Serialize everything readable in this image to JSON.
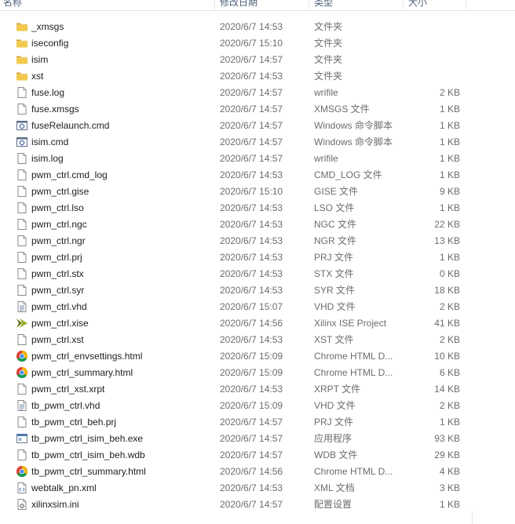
{
  "columns": {
    "name": "名称",
    "date": "修改日期",
    "type": "类型",
    "size": "大小"
  },
  "files": [
    {
      "name": "_xmsgs",
      "date": "2020/6/7 14:53",
      "type": "文件夹",
      "size": "",
      "icon": "folder-icon"
    },
    {
      "name": "iseconfig",
      "date": "2020/6/7 15:10",
      "type": "文件夹",
      "size": "",
      "icon": "folder-icon"
    },
    {
      "name": "isim",
      "date": "2020/6/7 14:57",
      "type": "文件夹",
      "size": "",
      "icon": "folder-icon"
    },
    {
      "name": "xst",
      "date": "2020/6/7 14:53",
      "type": "文件夹",
      "size": "",
      "icon": "folder-icon"
    },
    {
      "name": "fuse.log",
      "date": "2020/6/7 14:57",
      "type": "wrifile",
      "size": "2 KB",
      "icon": "file-icon"
    },
    {
      "name": "fuse.xmsgs",
      "date": "2020/6/7 14:57",
      "type": "XMSGS 文件",
      "size": "1 KB",
      "icon": "file-icon"
    },
    {
      "name": "fuseRelaunch.cmd",
      "date": "2020/6/7 14:57",
      "type": "Windows 命令脚本",
      "size": "1 KB",
      "icon": "cmd-script-icon"
    },
    {
      "name": "isim.cmd",
      "date": "2020/6/7 14:57",
      "type": "Windows 命令脚本",
      "size": "1 KB",
      "icon": "cmd-script-icon"
    },
    {
      "name": "isim.log",
      "date": "2020/6/7 14:57",
      "type": "wrifile",
      "size": "1 KB",
      "icon": "file-icon"
    },
    {
      "name": "pwm_ctrl.cmd_log",
      "date": "2020/6/7 14:53",
      "type": "CMD_LOG 文件",
      "size": "1 KB",
      "icon": "file-icon"
    },
    {
      "name": "pwm_ctrl.gise",
      "date": "2020/6/7 15:10",
      "type": "GISE 文件",
      "size": "9 KB",
      "icon": "file-icon"
    },
    {
      "name": "pwm_ctrl.lso",
      "date": "2020/6/7 14:53",
      "type": "LSO 文件",
      "size": "1 KB",
      "icon": "file-icon"
    },
    {
      "name": "pwm_ctrl.ngc",
      "date": "2020/6/7 14:53",
      "type": "NGC 文件",
      "size": "22 KB",
      "icon": "file-icon"
    },
    {
      "name": "pwm_ctrl.ngr",
      "date": "2020/6/7 14:53",
      "type": "NGR 文件",
      "size": "13 KB",
      "icon": "file-icon"
    },
    {
      "name": "pwm_ctrl.prj",
      "date": "2020/6/7 14:53",
      "type": "PRJ 文件",
      "size": "1 KB",
      "icon": "file-icon"
    },
    {
      "name": "pwm_ctrl.stx",
      "date": "2020/6/7 14:53",
      "type": "STX 文件",
      "size": "0 KB",
      "icon": "file-icon"
    },
    {
      "name": "pwm_ctrl.syr",
      "date": "2020/6/7 14:53",
      "type": "SYR 文件",
      "size": "18 KB",
      "icon": "file-icon"
    },
    {
      "name": "pwm_ctrl.vhd",
      "date": "2020/6/7 15:07",
      "type": "VHD 文件",
      "size": "2 KB",
      "icon": "text-file-icon"
    },
    {
      "name": "pwm_ctrl.xise",
      "date": "2020/6/7 14:56",
      "type": "Xilinx ISE Project",
      "size": "41 KB",
      "icon": "xilinx-ise-icon"
    },
    {
      "name": "pwm_ctrl.xst",
      "date": "2020/6/7 14:53",
      "type": "XST 文件",
      "size": "2 KB",
      "icon": "file-icon"
    },
    {
      "name": "pwm_ctrl_envsettings.html",
      "date": "2020/6/7 15:09",
      "type": "Chrome HTML D...",
      "size": "10 KB",
      "icon": "chrome-icon"
    },
    {
      "name": "pwm_ctrl_summary.html",
      "date": "2020/6/7 15:09",
      "type": "Chrome HTML D...",
      "size": "6 KB",
      "icon": "chrome-icon"
    },
    {
      "name": "pwm_ctrl_xst.xrpt",
      "date": "2020/6/7 14:53",
      "type": "XRPT 文件",
      "size": "14 KB",
      "icon": "file-icon"
    },
    {
      "name": "tb_pwm_ctrl.vhd",
      "date": "2020/6/7 15:09",
      "type": "VHD 文件",
      "size": "2 KB",
      "icon": "text-file-icon"
    },
    {
      "name": "tb_pwm_ctrl_beh.prj",
      "date": "2020/6/7 14:57",
      "type": "PRJ 文件",
      "size": "1 KB",
      "icon": "file-icon"
    },
    {
      "name": "tb_pwm_ctrl_isim_beh.exe",
      "date": "2020/6/7 14:57",
      "type": "应用程序",
      "size": "93 KB",
      "icon": "exe-icon"
    },
    {
      "name": "tb_pwm_ctrl_isim_beh.wdb",
      "date": "2020/6/7 14:57",
      "type": "WDB 文件",
      "size": "29 KB",
      "icon": "file-icon"
    },
    {
      "name": "tb_pwm_ctrl_summary.html",
      "date": "2020/6/7 14:56",
      "type": "Chrome HTML D...",
      "size": "4 KB",
      "icon": "chrome-icon"
    },
    {
      "name": "webtalk_pn.xml",
      "date": "2020/6/7 14:53",
      "type": "XML 文档",
      "size": "3 KB",
      "icon": "xml-icon"
    },
    {
      "name": "xilinxsim.ini",
      "date": "2020/6/7 14:57",
      "type": "配置设置",
      "size": "1 KB",
      "icon": "ini-settings-icon"
    }
  ],
  "colors": {
    "folder": "#e8b93a",
    "header_text": "#4c607a",
    "secondary_text": "#6d6d6d",
    "xilinx_green": "#7a8c1e"
  }
}
